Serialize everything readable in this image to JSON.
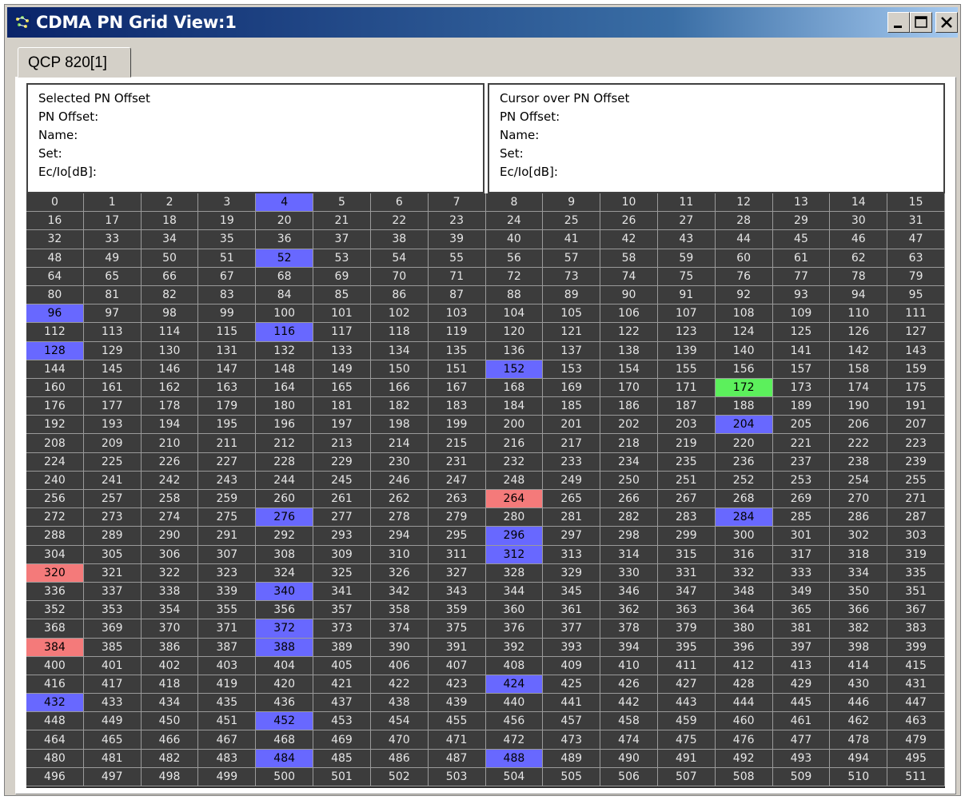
{
  "window": {
    "title": "CDMA PN Grid View:1",
    "colors": {
      "title_bar": "#0a246a",
      "grid_background": "#3c3c3c",
      "cell_text": "#e6e6e6"
    }
  },
  "controls": {
    "minimize_icon": "minimize-icon",
    "maximize_icon": "maximize-icon",
    "close_icon": "close-icon"
  },
  "tabs": [
    {
      "label": "QCP 820[1]",
      "selected": true
    }
  ],
  "selected_panel": {
    "heading": "Selected PN Offset",
    "pn_offset_label": "PN Offset:",
    "name_label": "Name:",
    "set_label": "Set:",
    "ecio_label": "Ec/Io[dB]:"
  },
  "cursor_panel": {
    "heading": "Cursor over PN Offset",
    "pn_offset_label": "PN Offset:",
    "name_label": "Name:",
    "set_label": "Set:",
    "ecio_label": "Ec/Io[dB]:"
  },
  "grid": {
    "columns": 16,
    "start": 0,
    "end": 511,
    "highlights": {
      "blue": [
        4,
        52,
        96,
        116,
        128,
        152,
        204,
        276,
        284,
        296,
        312,
        340,
        372,
        388,
        424,
        432,
        452,
        484,
        488
      ],
      "red": [
        264,
        320,
        384
      ],
      "green": [
        172
      ]
    },
    "highlight_colors": {
      "blue": "#6868ff",
      "red": "#f47a7a",
      "green": "#5cf05c"
    }
  }
}
